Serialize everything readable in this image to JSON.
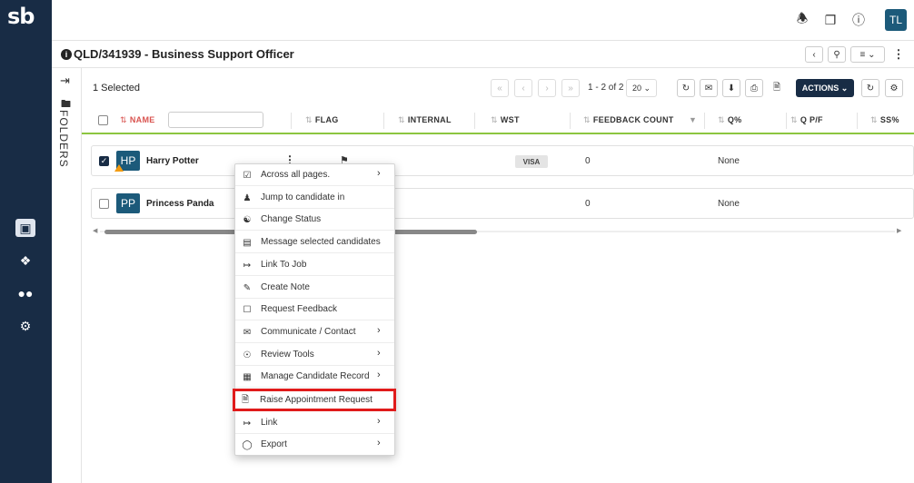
{
  "app": {
    "logo": "sb",
    "user_initials": "TL"
  },
  "job": {
    "title": "QLD/341939 - Business Support Officer"
  },
  "folders_label": "FOLDERS",
  "toolbar": {
    "selected_text": "1 Selected",
    "page_info": "1 - 2 of 2",
    "page_size": "20",
    "actions_label": "ACTIONS"
  },
  "columns": [
    {
      "label": "NAME"
    },
    {
      "label": "FLAG"
    },
    {
      "label": "INTERNAL"
    },
    {
      "label": "WST"
    },
    {
      "label": "FEEDBACK COUNT"
    },
    {
      "label": "Q%"
    },
    {
      "label": "Q P/F"
    },
    {
      "label": "SS%"
    }
  ],
  "rows": [
    {
      "initials": "HP",
      "name": "Harry Potter",
      "checked": true,
      "wst": "VISA",
      "feedback_count": "0",
      "q_pf": "None"
    },
    {
      "initials": "PP",
      "name": "Princess Panda",
      "checked": false,
      "wst": "",
      "feedback_count": "0",
      "q_pf": "None"
    }
  ],
  "context_menu": {
    "items": [
      {
        "label": "Across all pages.",
        "icon": "checklist-icon",
        "submenu": true
      },
      {
        "label": "Jump to candidate in",
        "icon": "person-jump-icon",
        "submenu": false
      },
      {
        "label": "Change Status",
        "icon": "people-status-icon",
        "submenu": false
      },
      {
        "label": "Message selected candidates",
        "icon": "message-icon",
        "submenu": false
      },
      {
        "label": "Link To Job",
        "icon": "link-arrow-icon",
        "submenu": false
      },
      {
        "label": "Create Note",
        "icon": "note-icon",
        "submenu": false
      },
      {
        "label": "Request Feedback",
        "icon": "feedback-icon",
        "submenu": false
      },
      {
        "label": "Communicate / Contact",
        "icon": "mail-icon",
        "submenu": true
      },
      {
        "label": "Review Tools",
        "icon": "review-icon",
        "submenu": true
      },
      {
        "label": "Manage Candidate Record",
        "icon": "record-icon",
        "submenu": true
      },
      {
        "label": "Raise Appointment Request",
        "icon": "document-plus-icon",
        "submenu": false,
        "highlighted": true
      },
      {
        "label": "Link",
        "icon": "link-arrow-icon",
        "submenu": true
      },
      {
        "label": "Export",
        "icon": "export-icon",
        "submenu": true
      }
    ]
  },
  "colors": {
    "nav_bg": "#182c45",
    "accent_green": "#8cc63f",
    "avatar_bg": "#1c5a7a",
    "highlight_red": "#e01b1b"
  }
}
